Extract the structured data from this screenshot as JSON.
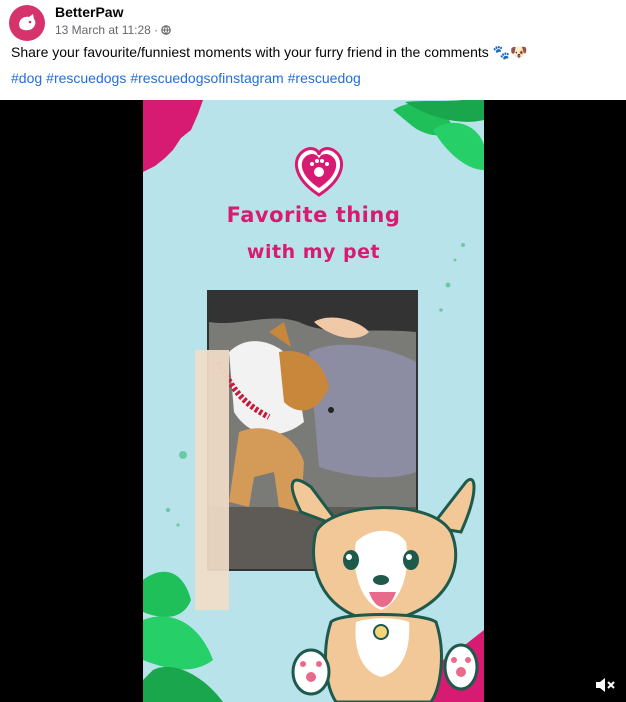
{
  "post": {
    "page_name": "BetterPaw",
    "timestamp": "13 March at 11:28 ·",
    "privacy_icon": "globe-icon",
    "text": "Share your favourite/funniest moments with your furry friend in the comments 🐾🐶",
    "hashtags": [
      "#dog",
      "#rescuedogs",
      "#rescuedogsofinstagram",
      "#rescuedog"
    ]
  },
  "video": {
    "title_line1": "Favorite thing",
    "title_line2": "with my pet",
    "controls": {
      "mute_icon": "muted-speaker-icon"
    }
  },
  "colors": {
    "brand": "#d6336c",
    "title": "#d81b72",
    "background": "#b9e3ea",
    "link": "#216fdb",
    "leaf": "#1fbf5a"
  }
}
